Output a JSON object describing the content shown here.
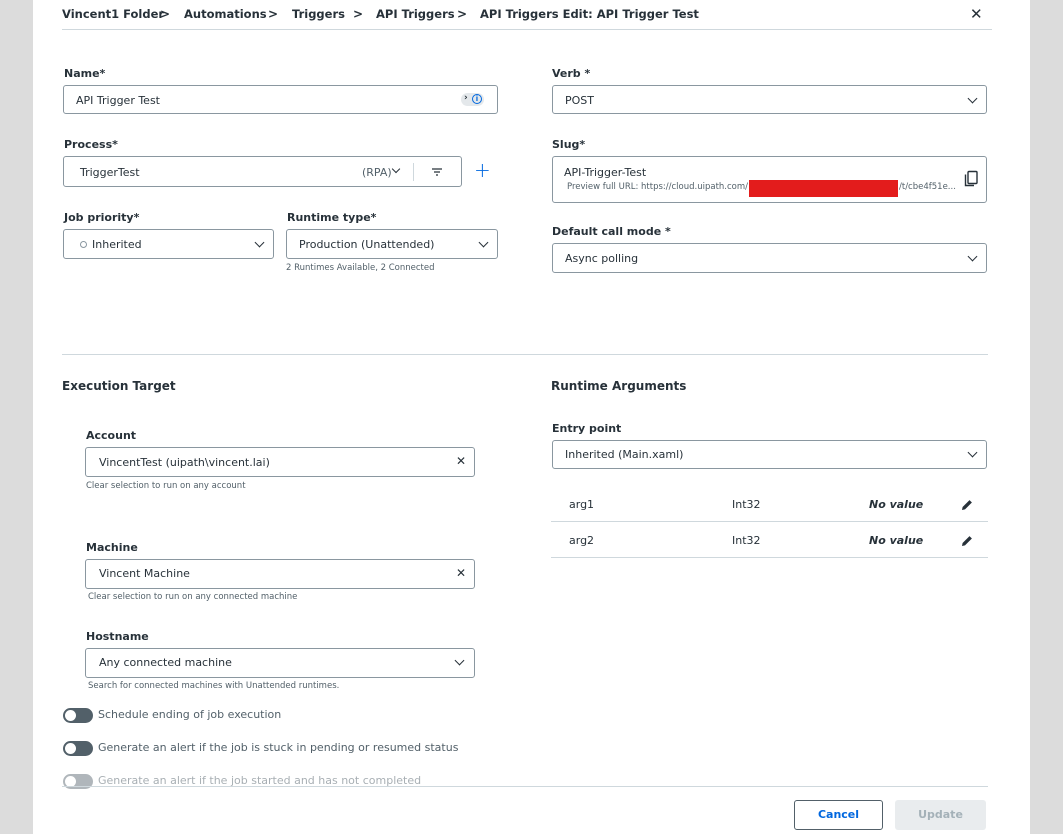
{
  "breadcrumb": {
    "items": [
      "Vincent1 Folder",
      "Automations",
      "Triggers",
      "API Triggers",
      "API Triggers Edit: API Trigger Test"
    ],
    "separator": ">",
    "close_icon": "close-icon"
  },
  "form": {
    "name": {
      "label": "Name*",
      "value": "API Trigger Test"
    },
    "verb": {
      "label": "Verb *",
      "value": "POST"
    },
    "process": {
      "label": "Process*",
      "value": "TriggerTest",
      "type_tag": "(RPA)"
    },
    "slug": {
      "label": "Slug*",
      "value": "API-Trigger-Test",
      "preview_prefix": "Preview full URL: https://cloud.uipath.com/",
      "preview_suffix": "/t/cbe4f51e..."
    },
    "job_priority": {
      "label": "Job priority*",
      "value": "Inherited"
    },
    "runtime_type": {
      "label": "Runtime type*",
      "value": "Production (Unattended)",
      "hint": "2 Runtimes Available, 2 Connected"
    },
    "default_call_mode": {
      "label": "Default call mode *",
      "value": "Async polling"
    }
  },
  "execution_target": {
    "title": "Execution Target",
    "account": {
      "label": "Account",
      "value": "VincentTest (uipath\\vincent.lai)",
      "hint": "Clear selection to run on any account"
    },
    "machine": {
      "label": "Machine",
      "value": "Vincent Machine",
      "hint": "Clear selection to run on any connected machine"
    },
    "hostname": {
      "label": "Hostname",
      "value": "Any connected machine",
      "hint": "Search for connected machines with Unattended runtimes."
    },
    "toggles": [
      "Schedule ending of job execution",
      "Generate an alert if the job is stuck in pending or resumed status",
      "Generate an alert if the job started and has not completed"
    ]
  },
  "runtime_arguments": {
    "title": "Runtime Arguments",
    "entry_point": {
      "label": "Entry point",
      "value": "Inherited (Main.xaml)"
    },
    "args": [
      {
        "name": "arg1",
        "type": "Int32",
        "value": "No value"
      },
      {
        "name": "arg2",
        "type": "Int32",
        "value": "No value"
      }
    ]
  },
  "footer": {
    "cancel_label": "Cancel",
    "update_label": "Update"
  },
  "colors": {
    "accent": "#0067df",
    "redaction": "#e31c1c",
    "disabled_button": "#e9ecee"
  }
}
